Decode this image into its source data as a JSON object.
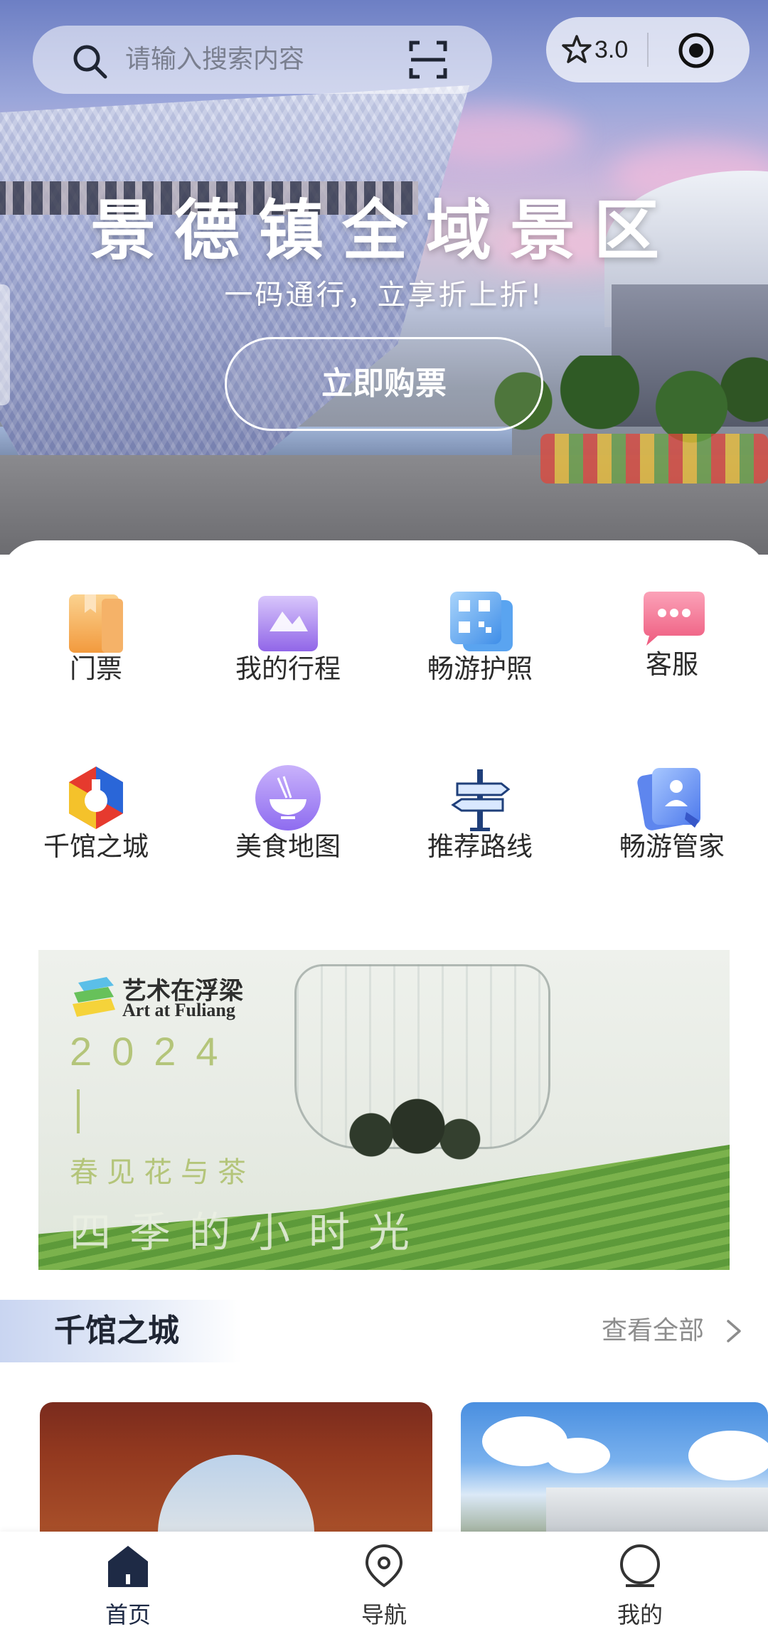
{
  "header": {
    "search_placeholder": "请输入搜索内容",
    "rating": "3.0"
  },
  "hero": {
    "title": "景德镇全域景区",
    "subtitle": "一码通行，立享折上折!",
    "button": "立即购票"
  },
  "grid": {
    "items": [
      {
        "label": "门票",
        "icon": "ticket-icon"
      },
      {
        "label": "我的行程",
        "icon": "itinerary-icon"
      },
      {
        "label": "畅游护照",
        "icon": "qr-passport-icon"
      },
      {
        "label": "客服",
        "icon": "chat-icon"
      },
      {
        "label": "千馆之城",
        "icon": "museum-city-icon"
      },
      {
        "label": "美食地图",
        "icon": "noodle-bowl-icon"
      },
      {
        "label": "推荐路线",
        "icon": "signpost-icon"
      },
      {
        "label": "畅游管家",
        "icon": "butler-card-icon"
      }
    ]
  },
  "banner": {
    "logo_cn": "艺术在浮梁",
    "logo_en": "Art at Fuliang",
    "year": "2024",
    "line1": "春见花与茶",
    "line2": "四季的小时光"
  },
  "section": {
    "title": "千馆之城",
    "more": "查看全部"
  },
  "tabbar": {
    "items": [
      {
        "label": "首页",
        "icon": "home-icon",
        "active": true
      },
      {
        "label": "导航",
        "icon": "location-pin-icon",
        "active": false
      },
      {
        "label": "我的",
        "icon": "profile-icon",
        "active": false
      }
    ]
  },
  "colors": {
    "accent": "#1e2a45",
    "section_highlight": "#c9d5f1",
    "banner_text": "#b4c57a"
  }
}
